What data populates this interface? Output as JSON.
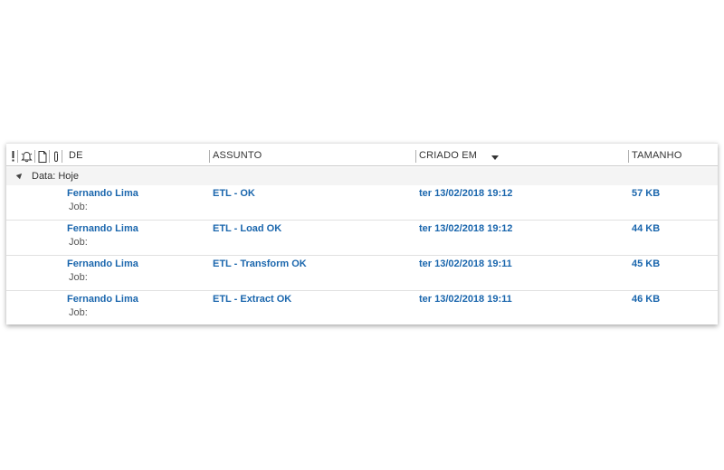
{
  "columns": {
    "from": "DE",
    "subject": "ASSUNTO",
    "created": "CRIADO EM",
    "size": "TAMANHO"
  },
  "header_icons": [
    "importance-icon",
    "reminder-icon",
    "item-type-icon",
    "attachment-icon"
  ],
  "group": {
    "label": "Data: Hoje"
  },
  "messages": [
    {
      "from": "Fernando Lima",
      "subject": "ETL - OK",
      "created": "ter 13/02/2018 19:12",
      "size": "57 KB",
      "preview": "Job:"
    },
    {
      "from": "Fernando Lima",
      "subject": "ETL - Load OK",
      "created": "ter 13/02/2018 19:12",
      "size": "44 KB",
      "preview": "Job:"
    },
    {
      "from": "Fernando Lima",
      "subject": "ETL - Transform OK",
      "created": "ter 13/02/2018 19:11",
      "size": "45 KB",
      "preview": "Job:"
    },
    {
      "from": "Fernando Lima",
      "subject": "ETL - Extract OK",
      "created": "ter 13/02/2018 19:11",
      "size": "46 KB",
      "preview": "Job:"
    }
  ],
  "colors": {
    "unread_text": "#1a66ad",
    "header_text": "#333333",
    "group_bg": "#f4f4f4"
  }
}
